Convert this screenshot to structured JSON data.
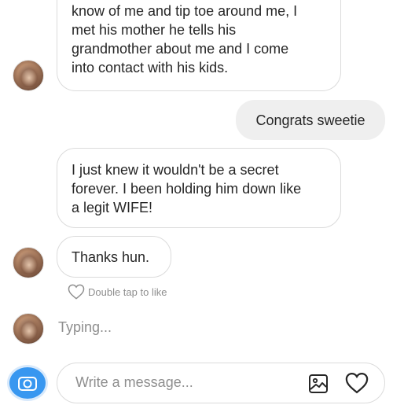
{
  "messages": [
    {
      "id": "m1",
      "direction": "incoming",
      "lines": [
        "know of me and tip toe around me, I",
        "met his mother he tells his",
        "grandmother about me and I come",
        "into contact with his kids."
      ]
    },
    {
      "id": "m2",
      "direction": "outgoing",
      "text": "Congrats sweetie"
    },
    {
      "id": "m3",
      "direction": "incoming",
      "lines": [
        "I just knew it wouldn't be a secret",
        "forever. I been holding him down like",
        "a legit WIFE!"
      ]
    },
    {
      "id": "m4",
      "direction": "incoming",
      "text": "Thanks hun."
    }
  ],
  "like_hint": "Double tap to like",
  "typing_indicator": "Typing...",
  "composer": {
    "placeholder": "Write a message..."
  },
  "icons": {
    "camera": "camera-icon",
    "gallery": "image-icon",
    "like": "heart-icon"
  },
  "colors": {
    "accent": "#3897f0",
    "outgoing_bubble": "#efefef",
    "muted_text": "#8e8e8e"
  }
}
